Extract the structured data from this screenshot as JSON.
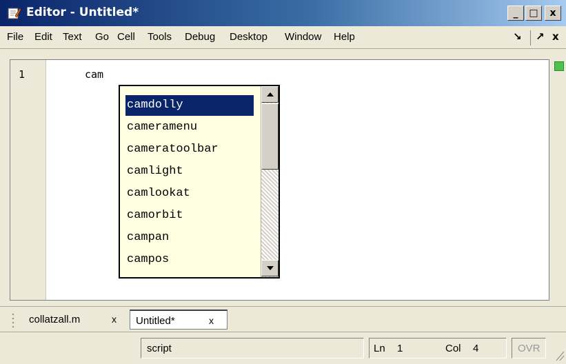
{
  "window": {
    "title": "Editor - Untitled*",
    "minimize": "_",
    "maximize": "□",
    "close": "x"
  },
  "menu": {
    "items": [
      "File",
      "Edit",
      "Text",
      "Go",
      "Cell",
      "Tools",
      "Debug",
      "Desktop",
      "Window",
      "Help"
    ],
    "undock": "↘",
    "dock": "↗",
    "close": "x"
  },
  "editor": {
    "line_number": "1",
    "code": "cam"
  },
  "autocomplete": {
    "selected_index": 0,
    "items": [
      "camdolly",
      "cameramenu",
      "cameratoolbar",
      "camlight",
      "camlookat",
      "camorbit",
      "campan",
      "campos"
    ]
  },
  "tabs": [
    {
      "label": "collatzall.m",
      "close": "x",
      "active": false
    },
    {
      "label": "Untitled*",
      "close": "x",
      "active": true
    }
  ],
  "status": {
    "mode": "script",
    "ln_label": "Ln",
    "ln_value": "1",
    "col_label": "Col",
    "col_value": "4",
    "ovr": "OVR"
  },
  "colors": {
    "selection": "#0a246a",
    "popup_bg": "#ffffe1",
    "indicator": "#4cc24c"
  }
}
